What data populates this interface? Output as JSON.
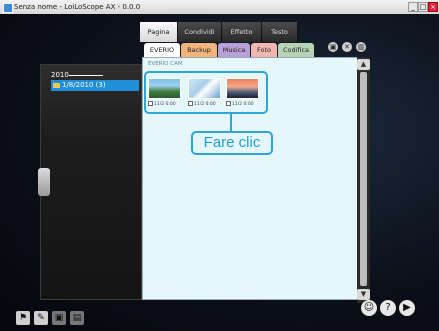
{
  "window": {
    "title": "Senza nome - LoiLoScope AX - 0.0.0",
    "min": "_",
    "max": "□",
    "close": "×"
  },
  "top_tabs": [
    {
      "label": "Pagina iniziale",
      "active": true
    },
    {
      "label": "Condividi",
      "active": false
    },
    {
      "label": "Effetto",
      "active": false
    },
    {
      "label": "Testo",
      "active": false
    }
  ],
  "sub_tabs": [
    {
      "label": "EVERIO CAM",
      "color": "#ffffff"
    },
    {
      "label": "Backup",
      "color": "#f1b47d"
    },
    {
      "label": "Musica",
      "color": "#b9a0d6"
    },
    {
      "label": "Foto",
      "color": "#f2b8b0"
    },
    {
      "label": "Codifica",
      "color": "#b6d3b6"
    }
  ],
  "circle_buttons": [
    {
      "label": "▣"
    },
    {
      "label": "✕"
    },
    {
      "label": "▥"
    }
  ],
  "left_panel": {
    "year": "2010",
    "date_item": "1/8/2010 (3)"
  },
  "main": {
    "breadcrumb": "EVERIO CAM",
    "thumbnails": [
      {
        "label": "11/2 0:00"
      },
      {
        "label": "11/2 0:00"
      },
      {
        "label": "11/2 0:00"
      }
    ]
  },
  "callout": {
    "text": "Fare clic"
  },
  "scroll": {
    "up": "▲",
    "down": "▼"
  },
  "bottom_icons": [
    "⚑",
    "✎",
    "▣",
    "▤"
  ],
  "bottom_right": [
    "☺",
    "?",
    "▶"
  ]
}
